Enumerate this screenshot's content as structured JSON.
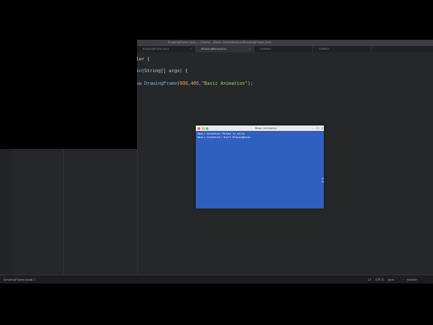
{
  "editor": {
    "window_title": "DrawingFrame.java — /Users/.../Basic Animation/src/DrawingFrame.java",
    "tabs": [
      {
        "label": "DrawingFrame.java",
        "active": false
      },
      {
        "label": "DrawingPanel.java",
        "active": true
      },
      {
        "label": "untitled",
        "active": false
      },
      {
        "label": "untitled",
        "active": false
      }
    ],
    "code": {
      "line1": "cler {",
      "line2_name": "ain",
      "line2_rest": "(String[] args) {",
      "line3_kw": "new",
      "line3_type": "DrawingFrame",
      "line3_args_open": "(",
      "line3_num1": "600",
      "line3_comma": ",",
      "line3_num2": "400",
      "line3_str": "\"Basic Animation\"",
      "line3_end": ");"
    },
    "status": {
      "file": "DrawingFrame.java",
      "pos": "5:1",
      "lf": "LF",
      "enc": "UTF-8",
      "lang": "Java",
      "git": "master"
    }
  },
  "app_window": {
    "title": "Basic Animation",
    "console_lines": [
      "Basic Animation thread is alive",
      "Basic Animation: Start DrawingPanel"
    ]
  },
  "colors": {
    "editor_bg": "#252729",
    "app_bg": "#2f5fbf"
  }
}
